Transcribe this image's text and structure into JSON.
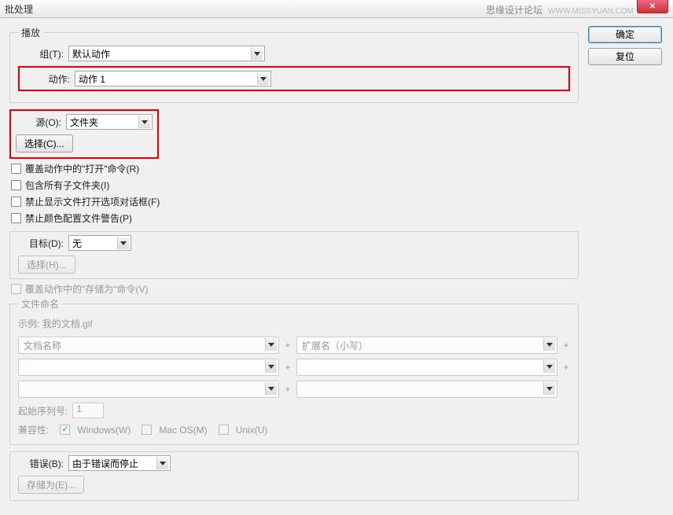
{
  "window": {
    "title": "批处理",
    "watermark": "思缘设计论坛",
    "watermark2": "WWW.MISSYUAN.COM"
  },
  "buttons": {
    "ok": "确定",
    "reset": "复位"
  },
  "play": {
    "legend": "播放",
    "set_label": "组(T):",
    "set_value": "默认动作",
    "action_label": "动作:",
    "action_value": "动作 1"
  },
  "source": {
    "label": "源(O):",
    "value": "文件夹",
    "choose": "选择(C)...",
    "override_open": "覆盖动作中的\"打开\"命令(R)",
    "include_sub": "包含所有子文件夹(I)",
    "suppress_open": "禁止显示文件打开选项对话框(F)",
    "suppress_color": "禁止颜色配置文件警告(P)"
  },
  "dest": {
    "label": "目标(D):",
    "value": "无",
    "choose": "选择(H)...",
    "override_save": "覆盖动作中的\"存储为\"命令(V)"
  },
  "naming": {
    "legend": "文件命名",
    "example_label": "示例:",
    "example_value": "我的文档.gif",
    "f1": "文档名称",
    "f2": "扩展名（小写）",
    "start_label": "起始序列号:",
    "start_value": "1",
    "compat_label": "兼容性:",
    "win": "Windows(W)",
    "mac": "Mac OS(M)",
    "unix": "Unix(U)",
    "plus": "+"
  },
  "error": {
    "label": "错误(B):",
    "value": "由于错误而停止",
    "saveas": "存储为(E)..."
  }
}
